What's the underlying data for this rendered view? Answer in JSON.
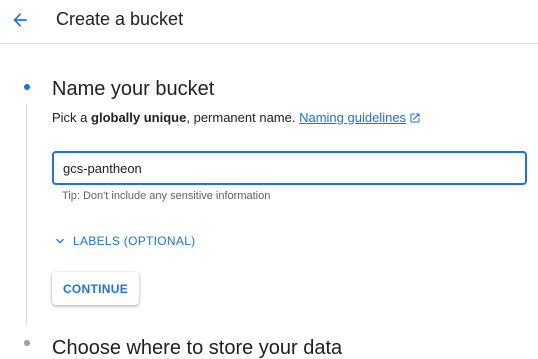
{
  "header": {
    "title": "Create a bucket",
    "back_icon": "arrow-back-icon"
  },
  "colors": {
    "accent": "#1a73e8",
    "text": "#202124",
    "muted": "#5f6368"
  },
  "step1": {
    "title": "Name your bucket",
    "subtitle_prefix": "Pick a ",
    "subtitle_bold": "globally unique",
    "subtitle_suffix": ", permanent name. ",
    "link_label": "Naming guidelines",
    "link_icon": "open-in-new-icon",
    "input_value": "gcs-pantheon",
    "hint": "Tip: Don't include any sensitive information",
    "labels_toggle": "LABELS (OPTIONAL)",
    "labels_icon": "chevron-down-icon",
    "continue_label": "CONTINUE"
  },
  "step2": {
    "title": "Choose where to store your data"
  }
}
